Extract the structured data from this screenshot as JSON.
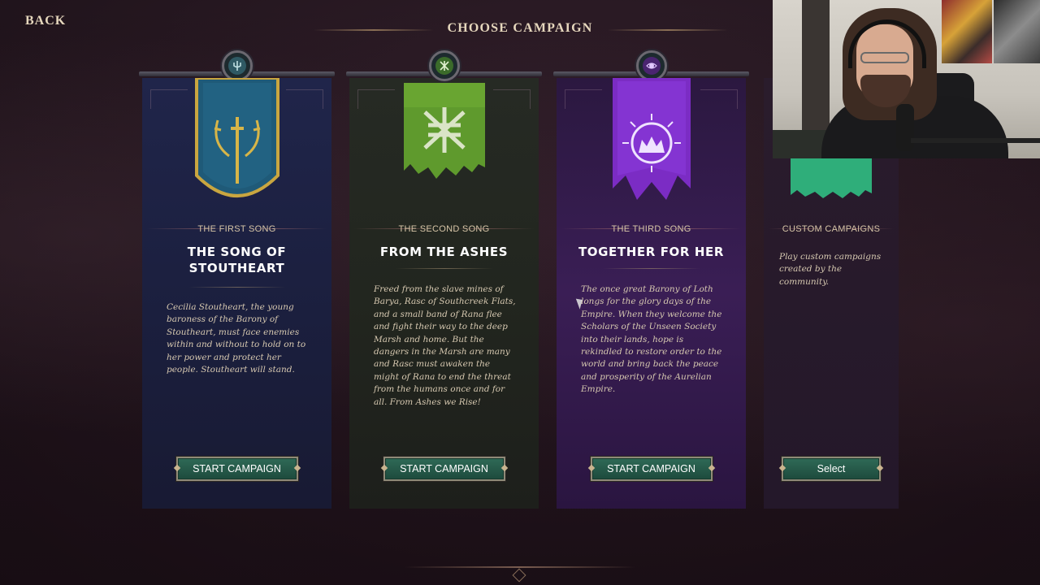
{
  "header": {
    "back_label": "BACK",
    "title": "CHOOSE CAMPAIGN"
  },
  "campaigns": [
    {
      "subtitle": "THE FIRST SONG",
      "title": "THE SONG OF STOUTHEART",
      "description": "Cecilia Stoutheart, the young baroness of the Barony of Stoutheart, must face enemies within and without to hold on to her power and protect her people. Stoutheart will stand.",
      "button": "START CAMPAIGN",
      "color": "#20254a",
      "banner_icon": "antler-sword-icon",
      "banner_color": "#1f5a78"
    },
    {
      "subtitle": "THE SECOND SONG",
      "title": "FROM THE ASHES",
      "description": "Freed from the slave mines of Barya, Rasc of Southcreek Flats, and a small band of Rana flee and fight their way to the deep Marsh and home. But the dangers in the Marsh are many and Rasc must awaken the might of Rana to end the threat from the humans once and for all. From Ashes we Rise!",
      "button": "START CAMPAIGN",
      "color": "#22261f",
      "banner_icon": "rune-icon",
      "banner_color": "#5f9a2d"
    },
    {
      "subtitle": "THE THIRD SONG",
      "title": "TOGETHER FOR HER",
      "description": "The once great Barony of Loth longs for the glory days of the Empire. When they welcome the Scholars of the Unseen Society into their lands, hope is rekindled to restore order to the world and bring back the peace and prosperity of the Aurelian Empire.",
      "button": "START CAMPAIGN",
      "color": "#3a1e55",
      "banner_icon": "crown-sun-icon",
      "banner_color": "#7b2cc4"
    },
    {
      "subtitle": "CUSTOM CAMPAIGNS",
      "title": "",
      "description": "Play custom campaigns created by the community.",
      "button": "Select",
      "color": "#24182a",
      "banner_icon": "custom-banner-icon",
      "banner_color": "#2fae7a"
    }
  ]
}
